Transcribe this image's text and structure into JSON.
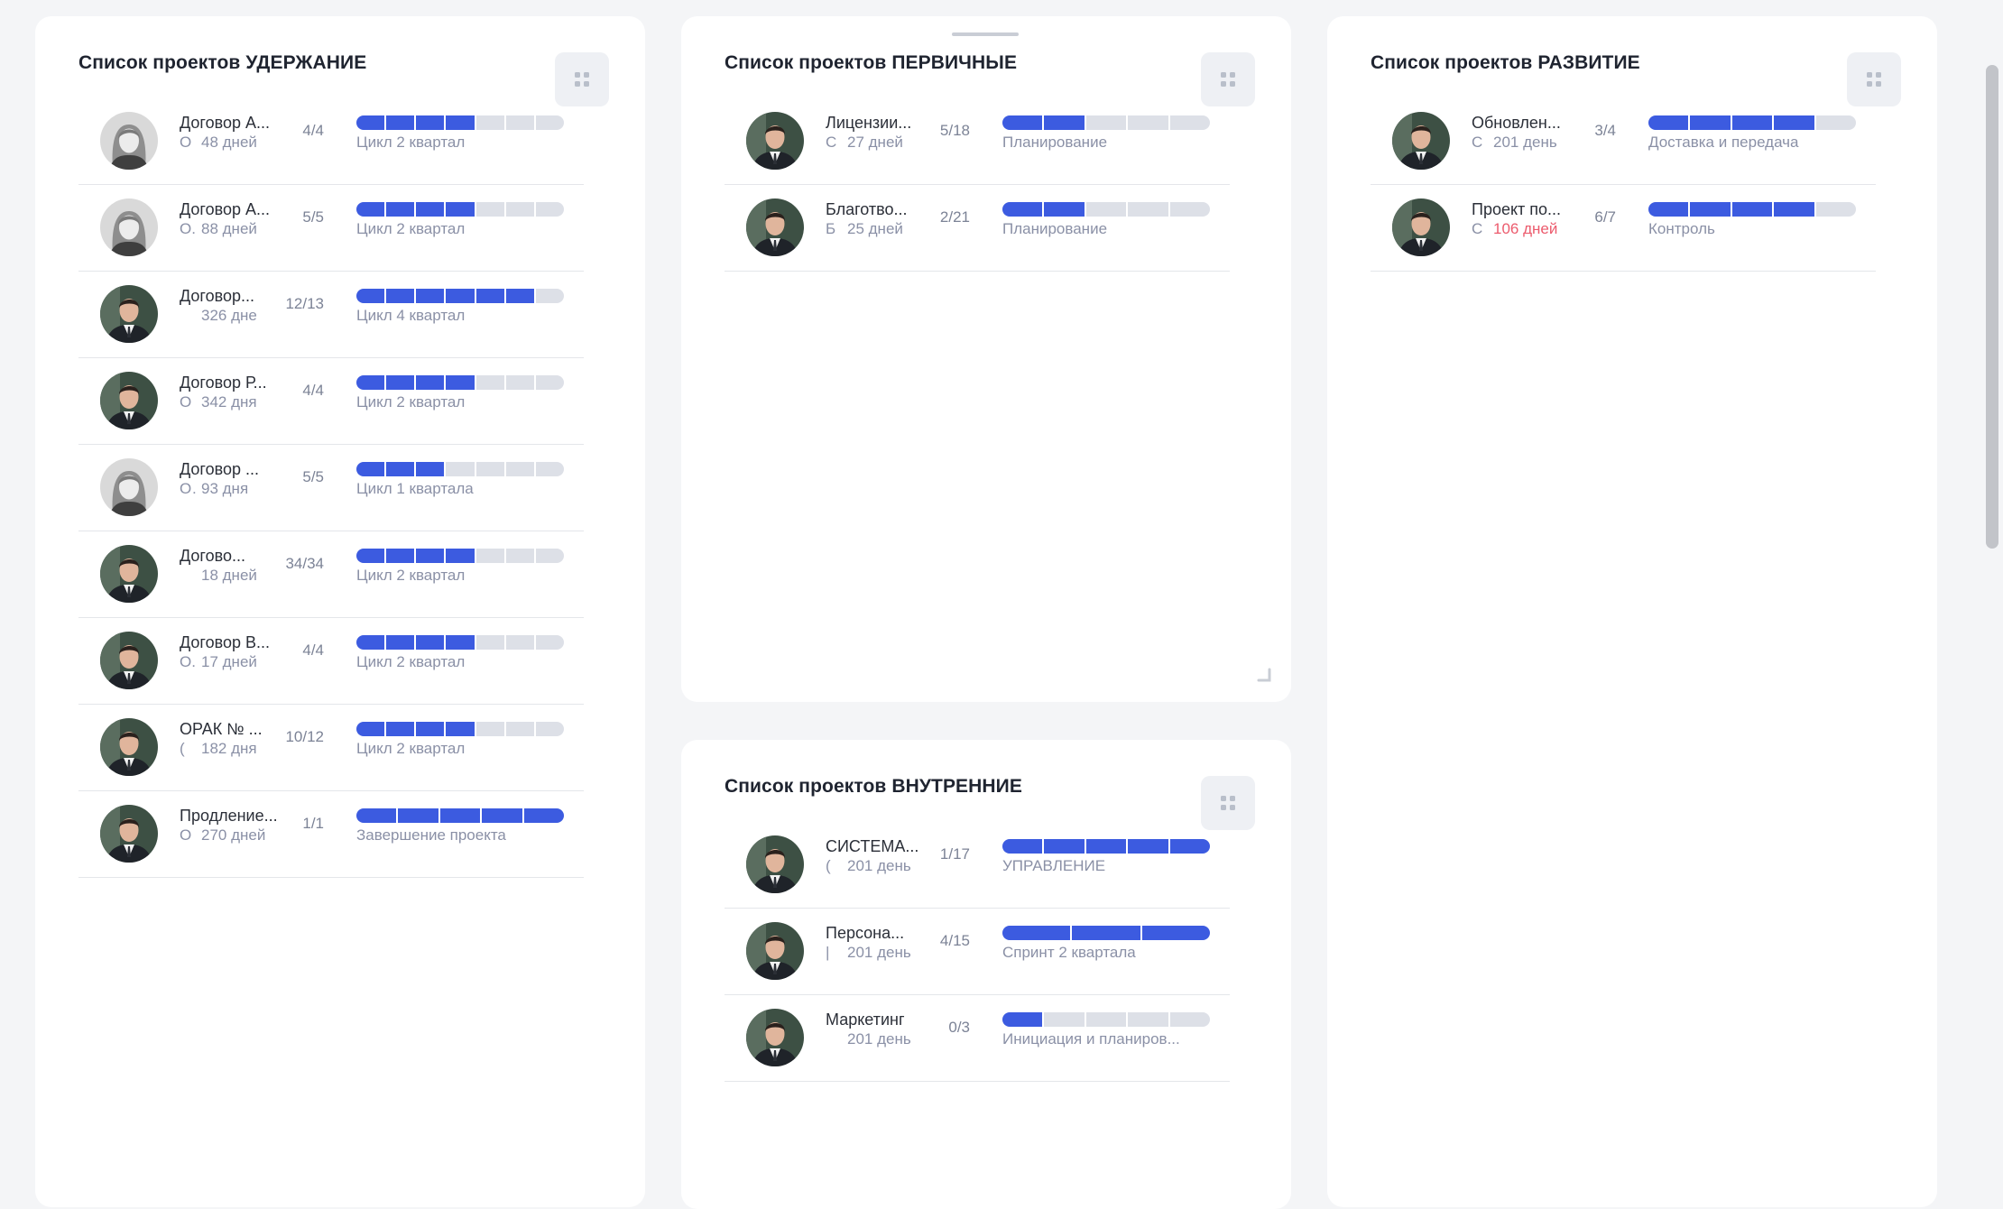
{
  "panels": [
    {
      "id": "retention",
      "title": "Список проектов УДЕРЖАНИЕ",
      "rows": [
        {
          "title": "Договор А...",
          "owner": "О",
          "days": "48 дней",
          "overdue": false,
          "count": "4/4",
          "progress": {
            "done": 4,
            "total": 7
          },
          "stage": "Цикл 2 квартал",
          "avatar": "woman"
        },
        {
          "title": "Договор А...",
          "owner": "О.",
          "days": "88 дней",
          "overdue": false,
          "count": "5/5",
          "progress": {
            "done": 4,
            "total": 7
          },
          "stage": "Цикл 2 квартал",
          "avatar": "woman"
        },
        {
          "title": "Договор...",
          "owner": "",
          "days": "326 дне",
          "overdue": false,
          "count": "12/13",
          "progress": {
            "done": 6,
            "total": 7
          },
          "stage": "Цикл 4 квартал",
          "avatar": "man"
        },
        {
          "title": "Договор Р...",
          "owner": "О",
          "days": "342 дня",
          "overdue": false,
          "count": "4/4",
          "progress": {
            "done": 4,
            "total": 7
          },
          "stage": "Цикл 2 квартал",
          "avatar": "man"
        },
        {
          "title": "Договор ...",
          "owner": "О...",
          "days": "93 дня",
          "overdue": false,
          "count": "5/5",
          "progress": {
            "done": 3,
            "total": 7
          },
          "stage": "Цикл 1 квартала",
          "avatar": "woman"
        },
        {
          "title": "Догово...",
          "owner": "",
          "days": "18 дней",
          "overdue": false,
          "count": "34/34",
          "progress": {
            "done": 4,
            "total": 7
          },
          "stage": "Цикл 2 квартал",
          "avatar": "man"
        },
        {
          "title": "Договор В...",
          "owner": "О.",
          "days": "17 дней",
          "overdue": false,
          "count": "4/4",
          "progress": {
            "done": 4,
            "total": 7
          },
          "stage": "Цикл 2 квартал",
          "avatar": "man"
        },
        {
          "title": "ОРАК № ...",
          "owner": "(",
          "days": "182 дня",
          "overdue": false,
          "count": "10/12",
          "progress": {
            "done": 4,
            "total": 7
          },
          "stage": "Цикл 2 квартал",
          "avatar": "man"
        },
        {
          "title": "Продление...",
          "owner": "О",
          "days": "270 дней",
          "overdue": false,
          "count": "1/1",
          "progress": {
            "done": 5,
            "total": 5
          },
          "stage": "Завершение проекта",
          "avatar": "man"
        }
      ]
    },
    {
      "id": "primary",
      "title": "Список проектов ПЕРВИЧНЫЕ",
      "rows": [
        {
          "title": "Лицензии...",
          "owner": "С",
          "days": "27 дней",
          "overdue": false,
          "count": "5/18",
          "progress": {
            "done": 2,
            "total": 5
          },
          "stage": "Планирование",
          "avatar": "man"
        },
        {
          "title": "Благотво...",
          "owner": "Б",
          "days": "25 дней",
          "overdue": false,
          "count": "2/21",
          "progress": {
            "done": 2,
            "total": 5
          },
          "stage": "Планирование",
          "avatar": "man"
        }
      ]
    },
    {
      "id": "internal",
      "title": "Список проектов ВНУТРЕННИЕ",
      "rows": [
        {
          "title": "СИСТЕМА...",
          "owner": "(",
          "days": "201 день",
          "overdue": false,
          "count": "1/17",
          "progress": {
            "done": 5,
            "total": 5
          },
          "stage": "УПРАВЛЕНИЕ",
          "avatar": "man"
        },
        {
          "title": "Персона...",
          "owner": "|",
          "days": "201 день",
          "overdue": false,
          "count": "4/15",
          "progress": {
            "done": 3,
            "total": 3
          },
          "stage": "Спринт 2 квартала",
          "avatar": "man"
        },
        {
          "title": "Маркетинг",
          "owner": "",
          "days": "201 день",
          "overdue": false,
          "count": "0/3",
          "progress": {
            "done": 1,
            "total": 5
          },
          "stage": "Инициация и планиров...",
          "avatar": "man"
        }
      ]
    },
    {
      "id": "development",
      "title": "Список проектов РАЗВИТИЕ",
      "rows": [
        {
          "title": "Обновлен...",
          "owner": "С",
          "days": "201 день",
          "overdue": false,
          "count": "3/4",
          "progress": {
            "done": 4,
            "total": 5
          },
          "stage": "Доставка и передача",
          "avatar": "man"
        },
        {
          "title": "Проект по...",
          "owner": "С",
          "days": "106 дней",
          "overdue": true,
          "count": "6/7",
          "progress": {
            "done": 4,
            "total": 5
          },
          "stage": "Контроль",
          "avatar": "man"
        }
      ]
    }
  ],
  "colors": {
    "progress_done": "#3c5be0",
    "progress_todo": "#dde0e7",
    "overdue_text": "#ec5b6d",
    "page_bg": "#f4f5f7",
    "panel_bg": "#ffffff"
  }
}
